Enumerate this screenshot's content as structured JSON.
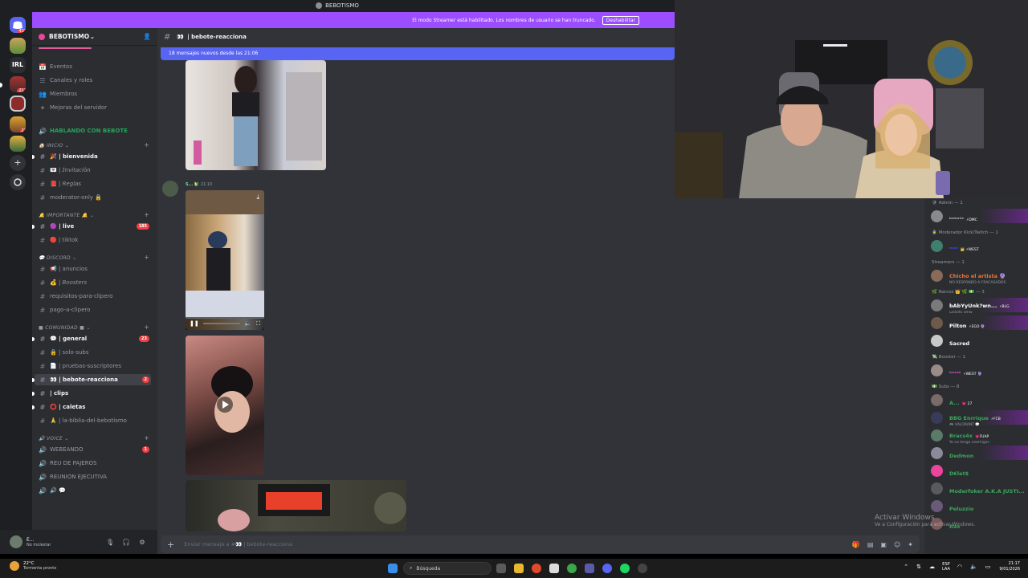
{
  "window": {
    "title": "BEBOTISMO"
  },
  "server_rail": {
    "top_badge": "433",
    "badges": [
      "211",
      "27"
    ]
  },
  "server": {
    "name": "BEBOTISMO"
  },
  "banner": {
    "text": "El modo Streamer está habilitado. Los nombres de usuario se han truncado.",
    "button": "Deshabilitar"
  },
  "channel_header": {
    "emoji": "👀",
    "name": "| bebote-reacciona"
  },
  "new_messages": {
    "text": "18 mensajes nuevos desde las 21:06"
  },
  "sidebar": {
    "top_items": [
      {
        "icon": "📅",
        "label": "Eventos"
      },
      {
        "icon": "☰",
        "label": "Canales y roles"
      },
      {
        "icon": "👥",
        "label": "Miembros"
      },
      {
        "icon": "✦",
        "label": "Mejoras del servidor"
      }
    ],
    "voice_status": "HABLANDO CON BEBOTE",
    "categories": [
      {
        "label": "🏠 INICIO ⌄",
        "channels": [
          {
            "name": "🎉 | bienvenida",
            "bright": true
          },
          {
            "name": "💌 | 𝘐𝘯𝘷𝘪𝘵𝘢𝘤𝘪ó𝘯"
          },
          {
            "name": "📕 | 𝘙𝘦𝘨𝘭𝘢𝘴"
          },
          {
            "name": "moderator-only 🔒"
          }
        ]
      },
      {
        "label": "🔔 IMPORTANTE 🔔 ⌄",
        "channels": [
          {
            "name": "🟣 | live",
            "bright": true,
            "badge": "185"
          },
          {
            "name": "🔴 | tiktok"
          }
        ]
      },
      {
        "label": "💬 DISCORD ⌄",
        "channels": [
          {
            "name": "📢 | anuncios"
          },
          {
            "name": "💰 | 𝘉𝘰𝘰𝘴𝘵𝘦𝘳𝘴"
          },
          {
            "name": "requisitos-para-clipero"
          },
          {
            "name": "pago-a-clipero"
          }
        ]
      },
      {
        "label": "■ COMUNIDAD ■ ⌄",
        "channels": [
          {
            "name": "💬 | general",
            "bright": true,
            "badge": "23"
          },
          {
            "name": "🔒 | solo-subs"
          },
          {
            "name": "📄 | pruebas-suscriptores"
          },
          {
            "name": "👀 | bebote-reacciona",
            "selected": true,
            "badge": "2"
          },
          {
            "name": "| clips",
            "bright": true
          },
          {
            "name": "⭕ | caletas",
            "bright": true
          },
          {
            "name": "🙏 | la-biblia-del-bebotismo"
          }
        ]
      },
      {
        "label": "🔊 VOICE ⌄",
        "channels": [
          {
            "name": "WEBEANDO",
            "badge": "1"
          },
          {
            "name": "REU DE PAJEROS"
          },
          {
            "name": "REUNION EJECUTIVA"
          },
          {
            "name": "🔊 💬"
          }
        ]
      }
    ]
  },
  "message": {
    "author": "S...",
    "tag": "🔰",
    "time": "21:10"
  },
  "user_panel": {
    "name": "E...",
    "status": "No molestar"
  },
  "composer": {
    "placeholder": "Enviar mensaje a #👀 | bebote-reacciona"
  },
  "members": {
    "groups": [
      {
        "label": "🛡 Admin — 1",
        "members": [
          {
            "name": "ᵇᵉᵇᵒᵗᵉ",
            "tag": "⚡DMC",
            "color": "#b9bbbe",
            "av": "#8a8a8a",
            "glow": true
          }
        ]
      },
      {
        "label": "👮 Moderador Kick/Twitch — 1",
        "members": [
          {
            "name": "ᵐᵒᵈ",
            "tag": "👑 ⚡WEST",
            "color": "#3b4bff",
            "av": "#3f7f6f"
          }
        ]
      },
      {
        "label": "Streamers — 1",
        "members": [
          {
            "name": "Chicho el artista 🔮",
            "sub": "NO RESPONDO A FRACASADOS",
            "color": "#e8783a",
            "av": "#8a6b5a"
          }
        ]
      },
      {
        "label": "🌿 Narcos 👑 🌿 💵 — 3",
        "members": [
          {
            "name": "bAbYyUnk?wn...",
            "tag": "⚡BLG",
            "sub": "ωolaito omw",
            "color": "#ffffff",
            "av": "#7a7a7a",
            "glow": true
          },
          {
            "name": "Pilton",
            "tag": "⚡EGO 🔮",
            "color": "#ffffff",
            "av": "#6e5a4a",
            "glow": true
          },
          {
            "name": "Sacred",
            "color": "#ffffff",
            "av": "#c8c8c8"
          }
        ]
      },
      {
        "label": "💸 Booster — 1",
        "members": [
          {
            "name": "ᵇᵒᵒˢᵗ",
            "tag": "⚡WEST 🔮",
            "color": "#d94fe0",
            "av": "#9a8a8a"
          }
        ]
      },
      {
        "label": "💵 Subs — 8",
        "members": [
          {
            "name": "A...",
            "tag": "💗 27",
            "color": "#3ba55c",
            "av": "#7a6a6a"
          },
          {
            "name": "BBG Enrrique",
            "tag": "⚡FCB",
            "sub": "🎮 VALORANT 💬",
            "color": "#3ba55c",
            "av": "#3a3a5a",
            "glow": true
          },
          {
            "name": "Bracs4x",
            "tag": "💗FUAP",
            "sub": "Yo no tengo enemigos",
            "color": "#3ba55c",
            "av": "#5a7a6a"
          },
          {
            "name": "Dedmon",
            "color": "#3ba55c",
            "av": "#8a8a9a",
            "glow": true
          },
          {
            "name": "D€let$",
            "color": "#3ba55c",
            "av": "#eb459e"
          },
          {
            "name": "Moderfoker A.K.A JUSTI...",
            "color": "#3ba55c",
            "av": "#5a5a5a"
          },
          {
            "name": "Peluzzio",
            "color": "#3ba55c",
            "av": "#6a5a7a"
          },
          {
            "name": "Rax",
            "color": "#3ba55c",
            "av": "#7a5a5a"
          }
        ]
      }
    ]
  },
  "watermark": {
    "title": "Activar Windows",
    "sub": "Ve a Configuración para activar Windows."
  },
  "taskbar": {
    "temp": "22°C",
    "weather": "Tormenta pronto",
    "search_placeholder": "Búsqueda",
    "lang_top": "ESP",
    "lang_bottom": "LAA",
    "time": "21:17",
    "date": "9/01/2026"
  }
}
